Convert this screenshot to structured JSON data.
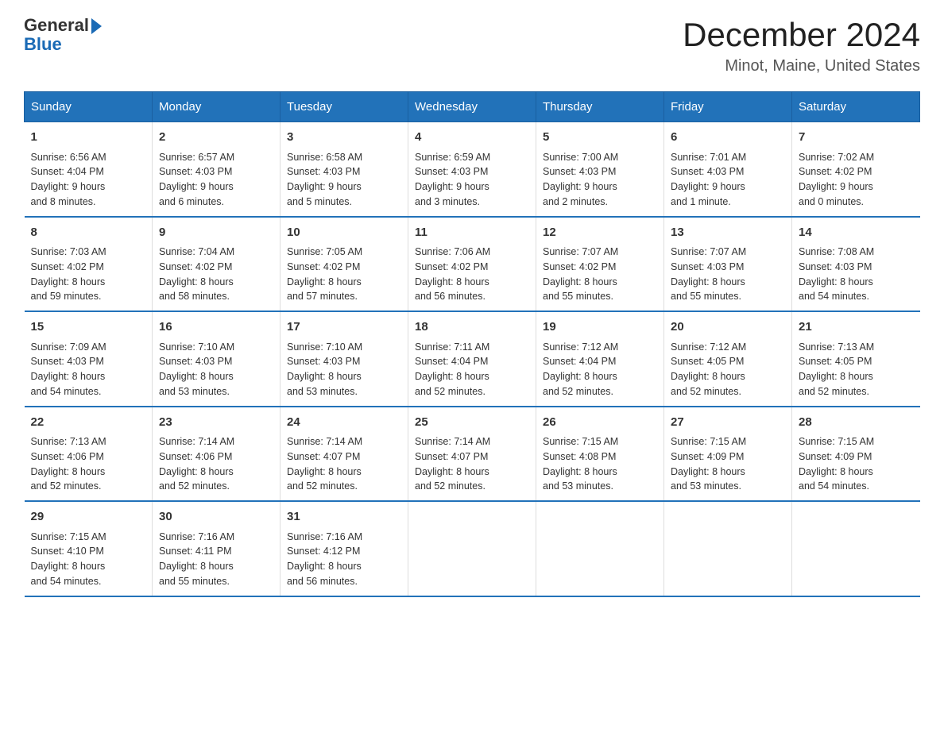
{
  "logo": {
    "text_general": "General",
    "text_blue": "Blue",
    "arrow": "▶"
  },
  "header": {
    "month": "December 2024",
    "location": "Minot, Maine, United States"
  },
  "weekdays": [
    "Sunday",
    "Monday",
    "Tuesday",
    "Wednesday",
    "Thursday",
    "Friday",
    "Saturday"
  ],
  "weeks": [
    [
      {
        "day": "1",
        "info": "Sunrise: 6:56 AM\nSunset: 4:04 PM\nDaylight: 9 hours\nand 8 minutes."
      },
      {
        "day": "2",
        "info": "Sunrise: 6:57 AM\nSunset: 4:03 PM\nDaylight: 9 hours\nand 6 minutes."
      },
      {
        "day": "3",
        "info": "Sunrise: 6:58 AM\nSunset: 4:03 PM\nDaylight: 9 hours\nand 5 minutes."
      },
      {
        "day": "4",
        "info": "Sunrise: 6:59 AM\nSunset: 4:03 PM\nDaylight: 9 hours\nand 3 minutes."
      },
      {
        "day": "5",
        "info": "Sunrise: 7:00 AM\nSunset: 4:03 PM\nDaylight: 9 hours\nand 2 minutes."
      },
      {
        "day": "6",
        "info": "Sunrise: 7:01 AM\nSunset: 4:03 PM\nDaylight: 9 hours\nand 1 minute."
      },
      {
        "day": "7",
        "info": "Sunrise: 7:02 AM\nSunset: 4:02 PM\nDaylight: 9 hours\nand 0 minutes."
      }
    ],
    [
      {
        "day": "8",
        "info": "Sunrise: 7:03 AM\nSunset: 4:02 PM\nDaylight: 8 hours\nand 59 minutes."
      },
      {
        "day": "9",
        "info": "Sunrise: 7:04 AM\nSunset: 4:02 PM\nDaylight: 8 hours\nand 58 minutes."
      },
      {
        "day": "10",
        "info": "Sunrise: 7:05 AM\nSunset: 4:02 PM\nDaylight: 8 hours\nand 57 minutes."
      },
      {
        "day": "11",
        "info": "Sunrise: 7:06 AM\nSunset: 4:02 PM\nDaylight: 8 hours\nand 56 minutes."
      },
      {
        "day": "12",
        "info": "Sunrise: 7:07 AM\nSunset: 4:02 PM\nDaylight: 8 hours\nand 55 minutes."
      },
      {
        "day": "13",
        "info": "Sunrise: 7:07 AM\nSunset: 4:03 PM\nDaylight: 8 hours\nand 55 minutes."
      },
      {
        "day": "14",
        "info": "Sunrise: 7:08 AM\nSunset: 4:03 PM\nDaylight: 8 hours\nand 54 minutes."
      }
    ],
    [
      {
        "day": "15",
        "info": "Sunrise: 7:09 AM\nSunset: 4:03 PM\nDaylight: 8 hours\nand 54 minutes."
      },
      {
        "day": "16",
        "info": "Sunrise: 7:10 AM\nSunset: 4:03 PM\nDaylight: 8 hours\nand 53 minutes."
      },
      {
        "day": "17",
        "info": "Sunrise: 7:10 AM\nSunset: 4:03 PM\nDaylight: 8 hours\nand 53 minutes."
      },
      {
        "day": "18",
        "info": "Sunrise: 7:11 AM\nSunset: 4:04 PM\nDaylight: 8 hours\nand 52 minutes."
      },
      {
        "day": "19",
        "info": "Sunrise: 7:12 AM\nSunset: 4:04 PM\nDaylight: 8 hours\nand 52 minutes."
      },
      {
        "day": "20",
        "info": "Sunrise: 7:12 AM\nSunset: 4:05 PM\nDaylight: 8 hours\nand 52 minutes."
      },
      {
        "day": "21",
        "info": "Sunrise: 7:13 AM\nSunset: 4:05 PM\nDaylight: 8 hours\nand 52 minutes."
      }
    ],
    [
      {
        "day": "22",
        "info": "Sunrise: 7:13 AM\nSunset: 4:06 PM\nDaylight: 8 hours\nand 52 minutes."
      },
      {
        "day": "23",
        "info": "Sunrise: 7:14 AM\nSunset: 4:06 PM\nDaylight: 8 hours\nand 52 minutes."
      },
      {
        "day": "24",
        "info": "Sunrise: 7:14 AM\nSunset: 4:07 PM\nDaylight: 8 hours\nand 52 minutes."
      },
      {
        "day": "25",
        "info": "Sunrise: 7:14 AM\nSunset: 4:07 PM\nDaylight: 8 hours\nand 52 minutes."
      },
      {
        "day": "26",
        "info": "Sunrise: 7:15 AM\nSunset: 4:08 PM\nDaylight: 8 hours\nand 53 minutes."
      },
      {
        "day": "27",
        "info": "Sunrise: 7:15 AM\nSunset: 4:09 PM\nDaylight: 8 hours\nand 53 minutes."
      },
      {
        "day": "28",
        "info": "Sunrise: 7:15 AM\nSunset: 4:09 PM\nDaylight: 8 hours\nand 54 minutes."
      }
    ],
    [
      {
        "day": "29",
        "info": "Sunrise: 7:15 AM\nSunset: 4:10 PM\nDaylight: 8 hours\nand 54 minutes."
      },
      {
        "day": "30",
        "info": "Sunrise: 7:16 AM\nSunset: 4:11 PM\nDaylight: 8 hours\nand 55 minutes."
      },
      {
        "day": "31",
        "info": "Sunrise: 7:16 AM\nSunset: 4:12 PM\nDaylight: 8 hours\nand 56 minutes."
      },
      null,
      null,
      null,
      null
    ]
  ]
}
